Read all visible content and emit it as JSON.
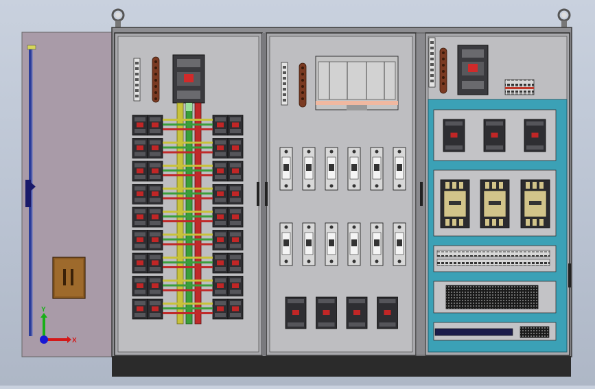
{
  "viewport": {
    "background_top": "#c9d1de",
    "background_bottom": "#aeb7c6"
  },
  "model": {
    "panel_fill": "#b9b9bd",
    "plate_fill": "#c0c0c2",
    "door_fill": "#a69aa6",
    "teal_frame": "#3ba1b6",
    "plinth_fill": "#2e2e2e",
    "busbar_colors": {
      "yellow": "#c8c23a",
      "green": "#3a9e3a",
      "red": "#c02a2a"
    }
  },
  "triad": {
    "x_label": "X",
    "y_label": "Y",
    "x_color": "#d41818",
    "y_color": "#18b018",
    "z_color": "#1818d4"
  }
}
